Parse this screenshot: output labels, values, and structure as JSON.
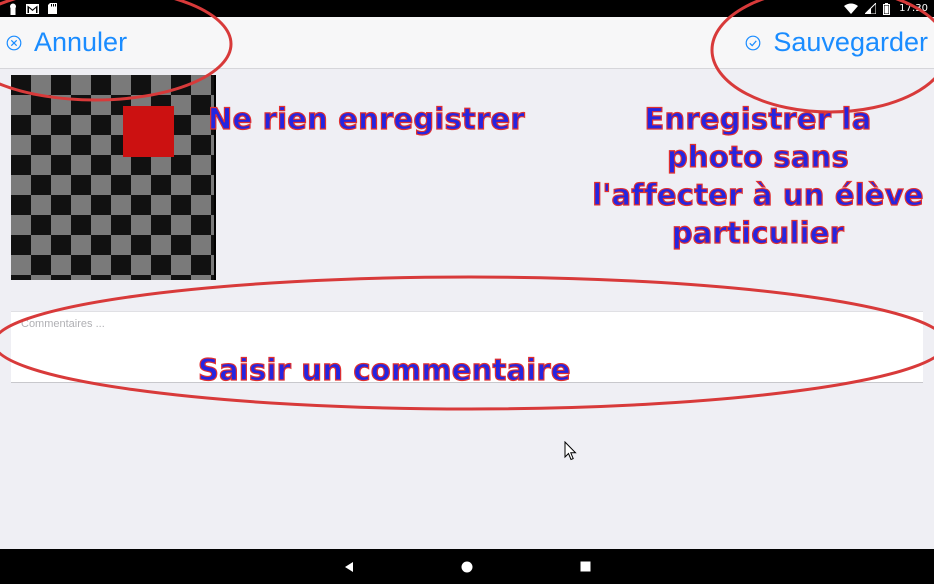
{
  "status_bar": {
    "time": "17:30",
    "left_icons": [
      "keyhole-icon",
      "gmail-icon",
      "sd-card-icon"
    ],
    "right_icons": [
      "wifi-icon",
      "signal-icon",
      "battery-icon"
    ]
  },
  "header": {
    "cancel_label": "Annuler",
    "cancel_icon": "x-circle-icon",
    "save_label": "Sauvegarder",
    "save_icon": "check-circle-icon",
    "accent_color": "#1a8cff"
  },
  "photo": {
    "alt": "checkerboard photo with red square"
  },
  "comment": {
    "placeholder": "Commentaires ...",
    "value": ""
  },
  "annotations": {
    "cancel_note": "Ne rien enregistrer",
    "save_note_lines": [
      "Enregistrer la",
      "photo sans",
      "l'affecter à un élève",
      "particulier"
    ],
    "comment_note": "Saisir un commentaire",
    "text_color": "#2525e0",
    "outline_color": "#e03030"
  },
  "android_nav": {
    "keys": [
      "back-icon",
      "home-icon",
      "recents-icon"
    ]
  }
}
